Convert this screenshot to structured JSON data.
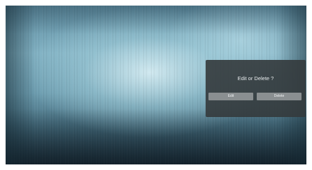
{
  "dialog": {
    "title": "Edit or Delete ?",
    "edit_label": "Edit",
    "delete_label": "Delete"
  },
  "colors": {
    "dialog_background": "#343a3c",
    "button_background": "#8a8f91",
    "text": "#e8ecee"
  }
}
